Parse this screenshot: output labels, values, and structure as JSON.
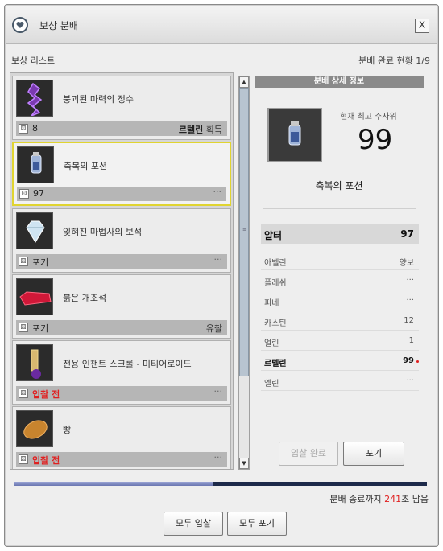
{
  "window": {
    "title": "보상 분배",
    "close_label": "X"
  },
  "list": {
    "title": "보상 리스트",
    "status": "분배 완료 현황 1/9",
    "items": [
      {
        "name": "붕괴된 마력의 정수",
        "roll": "8",
        "roll_red": false,
        "winner": "르텔린",
        "winner_suffix": "획득"
      },
      {
        "name": "축복의 포션",
        "roll": "97",
        "roll_red": false,
        "winner": "",
        "winner_suffix": "···"
      },
      {
        "name": "잊혀진 마법사의 보석",
        "roll": "포기",
        "roll_red": false,
        "winner": "",
        "winner_suffix": "···"
      },
      {
        "name": "붉은 개조석",
        "roll": "포기",
        "roll_red": false,
        "winner": "",
        "winner_suffix": "유찰"
      },
      {
        "name": "전용 인챈트 스크롤 - 미티어로이드",
        "roll": "입찰 전",
        "roll_red": true,
        "winner": "",
        "winner_suffix": "···"
      },
      {
        "name": "빵",
        "roll": "입찰 전",
        "roll_red": true,
        "winner": "",
        "winner_suffix": "···"
      }
    ],
    "dice_glyph": "⚄"
  },
  "detail": {
    "header": "분배 상세 정보",
    "highest_label": "현재 최고 주사위",
    "highest_value": "99",
    "item_name": "축복의 포션",
    "rolls": [
      {
        "name": "알터",
        "value": "97"
      },
      {
        "name": "아벨린",
        "value": "양보"
      },
      {
        "name": "플레쉬",
        "value": "···"
      },
      {
        "name": "피네",
        "value": "···"
      },
      {
        "name": "카스틴",
        "value": "12"
      },
      {
        "name": "얼린",
        "value": "1"
      },
      {
        "name": "르텔린",
        "value": "99"
      },
      {
        "name": "엘린",
        "value": "···"
      }
    ],
    "bid_done_label": "입찰 완료",
    "give_up_label": "포기"
  },
  "progress": {
    "fraction": 0.48
  },
  "timer": {
    "prefix": "분배 종료까지 ",
    "seconds": "241",
    "suffix": "초 남음"
  },
  "footer": {
    "bid_all_label": "모두 입찰",
    "give_up_all_label": "모두 포기"
  }
}
